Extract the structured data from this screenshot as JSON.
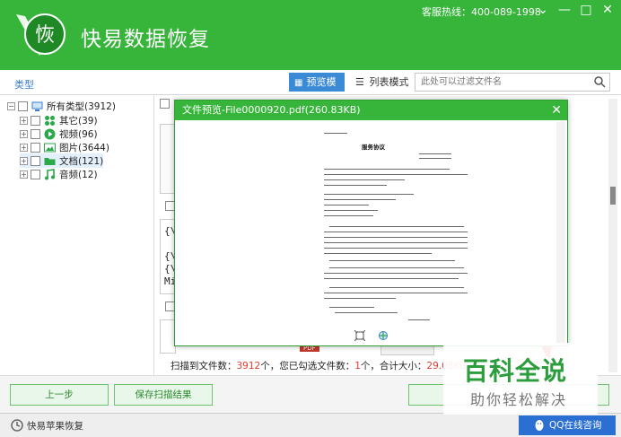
{
  "header": {
    "logo_char": "恢",
    "title": "快易数据恢复",
    "hotline": "客服热线：400-089-1998",
    "controls": [
      "⌄",
      "—",
      "□",
      "✕"
    ]
  },
  "toolbar": {
    "type_label": "类型",
    "preview_mode": "预览模式",
    "list_mode": "列表模式",
    "filter_placeholder": "此处可以过滤文件名"
  },
  "tree": {
    "root": "所有类型(3912)",
    "items": [
      {
        "label": "其它(39)",
        "icon": "grid-icon",
        "color": "#2aa84a"
      },
      {
        "label": "视频(96)",
        "icon": "play-icon",
        "color": "#2aa84a"
      },
      {
        "label": "图片(3644)",
        "icon": "image-icon",
        "color": "#2aa84a"
      },
      {
        "label": "文档(121)",
        "icon": "folder-icon",
        "color": "#2aa84a"
      },
      {
        "label": "音频(12)",
        "icon": "music-icon",
        "color": "#2aa84a"
      }
    ]
  },
  "content": {
    "code_snippet": "{\\r\n\n{\\f\n{\\f\nMi",
    "pdf_label": "PDF"
  },
  "preview": {
    "title": "文件预览-File0000920.pdf(260.83KB)",
    "close": "✕",
    "doc_heading": "服务协议"
  },
  "status": {
    "prefix": "扫描到文件数：",
    "found": "3912",
    "mid": "个，您已勾选文件数：",
    "selected": "1",
    "mid2": "个，合计大小：",
    "size": "29.08KB",
    "suffix": "。"
  },
  "buttons": {
    "prev": "上一步",
    "save": "保存扫描结果"
  },
  "footer": {
    "apple_recovery": "快易苹果恢复",
    "qq": "QQ在线咨询"
  },
  "watermark": {
    "big": "百科全说",
    "small": "助你轻松解决"
  },
  "colors": {
    "brand_green": "#36b53a",
    "accent_blue": "#3a8ad6",
    "highlight_red": "#e03a2f"
  }
}
